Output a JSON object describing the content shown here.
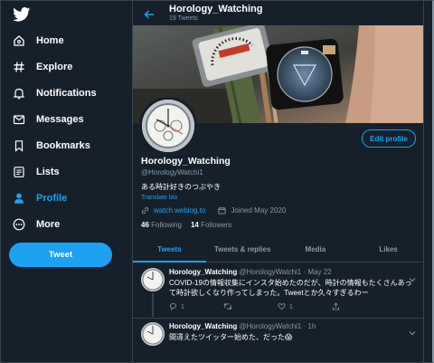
{
  "sidebar": {
    "logo_icon": "twitter-bird-icon",
    "items": [
      {
        "label": "Home",
        "icon": "home-icon"
      },
      {
        "label": "Explore",
        "icon": "hashtag-icon"
      },
      {
        "label": "Notifications",
        "icon": "bell-icon"
      },
      {
        "label": "Messages",
        "icon": "envelope-icon"
      },
      {
        "label": "Bookmarks",
        "icon": "bookmark-icon"
      },
      {
        "label": "Lists",
        "icon": "list-icon"
      },
      {
        "label": "Profile",
        "icon": "person-icon",
        "active": true
      },
      {
        "label": "More",
        "icon": "more-circle-icon"
      }
    ],
    "tweet_button": "Tweet"
  },
  "header": {
    "title": "Horology_Watching",
    "subtitle": "19 Tweets"
  },
  "profile": {
    "edit_button": "Edit profile",
    "name": "Horology_Watching",
    "handle": "@HorologyWatchi1",
    "bio": "ある時計好きのつぶやき",
    "translate": "Translate bio",
    "website": "watch.weblog.to",
    "joined": "Joined May 2020",
    "following_count": "46",
    "following_label": "Following",
    "followers_count": "14",
    "followers_label": "Followers"
  },
  "tabs": [
    {
      "label": "Tweets",
      "active": true
    },
    {
      "label": "Tweets & replies"
    },
    {
      "label": "Media"
    },
    {
      "label": "Likes"
    }
  ],
  "tweets": [
    {
      "name": "Horology_Watching",
      "handle": "@HorologyWatchi1",
      "time": "· May 22",
      "text": "COVID-19の情報収集にインスタ始めたのだが、時計の情報もたくさんあって時計欲しくなり作ってしまった。Tweetとか久々すぎるわー",
      "replies": "1",
      "retweets": "",
      "likes": "1"
    },
    {
      "name": "Horology_Watching",
      "handle": "@HorologyWatchi1",
      "time": "· 1h",
      "text": "間違えたツイッター始めた、だった😱"
    }
  ],
  "colors": {
    "background": "#15202b",
    "accent": "#1da1f2",
    "muted": "#8899a6",
    "border": "#38444d"
  }
}
